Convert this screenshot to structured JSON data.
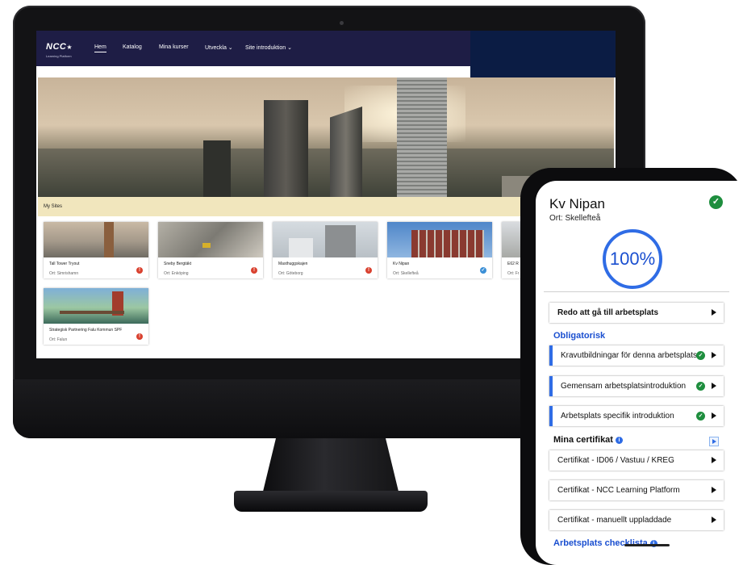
{
  "nav": {
    "logo": "NCC",
    "logo_sub": "Learning Platform",
    "items": [
      {
        "label": "Hem"
      },
      {
        "label": "Katalog"
      },
      {
        "label": "Mina kurser"
      },
      {
        "label": "Utveckla ⌄"
      },
      {
        "label": "Site introduktion ⌄"
      }
    ]
  },
  "my_sites": {
    "title": "My Sites",
    "cards": [
      {
        "title": "Tall Tower Tryout",
        "location": "Ort: Simrishamn",
        "status": "warn",
        "status_symbol": "!"
      },
      {
        "title": "Sneby Bergtäkt",
        "location": "Ort: Enköping",
        "status": "warn",
        "status_symbol": "!"
      },
      {
        "title": "Masthuggskajen",
        "location": "Ort: Göteborg",
        "status": "warn",
        "status_symbol": "!"
      },
      {
        "title": "Kv Nipan",
        "location": "Ort: Skellefteå",
        "status": "ok",
        "status_symbol": "✓"
      },
      {
        "title": "E62 R",
        "location": "Ort: Fr",
        "status": "",
        "status_symbol": ""
      },
      {
        "title": "Strategisk Partnering Falu Kommun SPF",
        "location": "Ort: Falun",
        "status": "warn",
        "status_symbol": "!"
      }
    ]
  },
  "phone": {
    "title": "Kv Nipan",
    "subtitle": "Ort: Skellefteå",
    "check_symbol": "✓",
    "progress": "100%",
    "ready_label": "Redo att gå till arbetsplats",
    "obligatory_title": "Obligatorisk",
    "obligatory_items": [
      {
        "label": "Kravutbildningar för denna arbetsplats"
      },
      {
        "label": "Gemensam arbetsplatsintroduktion"
      },
      {
        "label": "Arbetsplats specifik introduktion"
      }
    ],
    "certs_title": "Mina certifikat",
    "info_symbol": "i",
    "certs": [
      {
        "label": "Certifikat - ID06 / Vastuu / KREG"
      },
      {
        "label": "Certifikat - NCC Learning Platform"
      },
      {
        "label": "Certifikat - manuellt uppladdade"
      }
    ],
    "checklist_title": "Arbetsplats checklista"
  },
  "colors": {
    "nav_bg": "#1e1d45",
    "mysites_bar": "#f1e6bd",
    "accent_blue": "#2f6ce5",
    "ok_green": "#1e8e3e",
    "warn_red": "#d9412f"
  }
}
